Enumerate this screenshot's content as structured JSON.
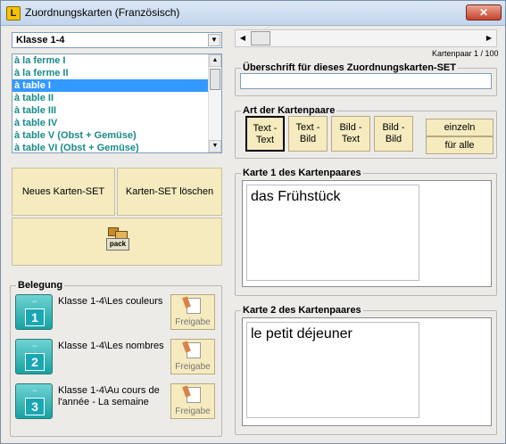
{
  "window": {
    "title": "Zuordnungskarten (Französisch)",
    "close_label": "✕",
    "app_icon_letter": "L"
  },
  "class_select": {
    "value": "Klasse 1-4"
  },
  "set_list": {
    "items": [
      {
        "label": "à la ferme I",
        "selected": false
      },
      {
        "label": "à la ferme II",
        "selected": false
      },
      {
        "label": "à table I",
        "selected": true
      },
      {
        "label": "à table II",
        "selected": false
      },
      {
        "label": "à table III",
        "selected": false
      },
      {
        "label": "à table IV",
        "selected": false
      },
      {
        "label": "à table V (Obst + Gemüse)",
        "selected": false
      },
      {
        "label": "à table VI (Obst + Gemüse)",
        "selected": false
      }
    ]
  },
  "buttons": {
    "new_set": "Neues Karten-SET",
    "delete_set": "Karten-SET löschen",
    "pack_label": "pack"
  },
  "pager": {
    "counter": "Kartenpaar 1 / 100"
  },
  "heading_group": {
    "legend": "Überschrift für dieses Zuordnungskarten-SET",
    "value": ""
  },
  "pair_type": {
    "legend": "Art der Kartenpaare",
    "options": [
      {
        "line1": "Text -",
        "line2": "Text",
        "active": true
      },
      {
        "line1": "Text -",
        "line2": "Bild",
        "active": false
      },
      {
        "line1": "Bild -",
        "line2": "Text",
        "active": false
      },
      {
        "line1": "Bild -",
        "line2": "Bild",
        "active": false
      }
    ],
    "mode_single": "einzeln",
    "mode_all": "für alle"
  },
  "card1": {
    "legend": "Karte 1 des Kartenpaares",
    "text": "das Frühstück"
  },
  "card2": {
    "legend": "Karte 2 des Kartenpaares",
    "text": "le petit déjeuner"
  },
  "belegung": {
    "legend": "Belegung",
    "slots": [
      {
        "number": "1",
        "label": "Klasse 1-4\\Les couleurs",
        "release": "Freigabe"
      },
      {
        "number": "2",
        "label": "Klasse 1-4\\Les nombres",
        "release": "Freigabe"
      },
      {
        "number": "3",
        "label": "Klasse 1-4\\Au cours de l'année - La semaine",
        "release": "Freigabe"
      }
    ]
  }
}
